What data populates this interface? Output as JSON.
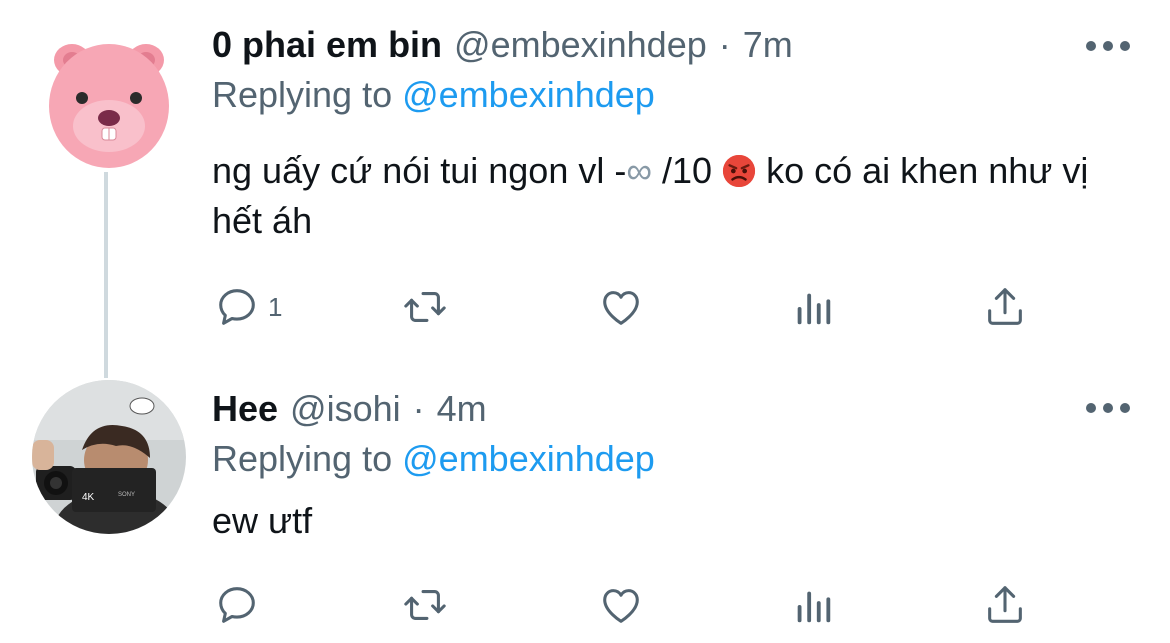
{
  "tweets": [
    {
      "display_name": "0 phai em bin",
      "handle": "@embexinhdep",
      "separator": "·",
      "time": "7m",
      "replying_prefix": "Replying to",
      "replying_to": "@embexinhdep",
      "text_part1": "ng uấy cứ nói tui ngon vl -",
      "text_infinity": "∞",
      "text_part2": " /10",
      "text_part3": " ko có ai khen như vị hết áh",
      "emoji": "angry-face-emoji",
      "reply_count": "1",
      "avatar": "pink-beaver-avatar"
    },
    {
      "display_name": "Hee",
      "handle": "@isohi",
      "separator": "·",
      "time": "4m",
      "replying_prefix": "Replying to",
      "replying_to": "@embexinhdep",
      "text": "ew ưtf",
      "reply_count": "",
      "avatar": "person-with-camera-avatar"
    }
  ],
  "icons": [
    "reply-icon",
    "retweet-icon",
    "like-icon",
    "analytics-icon",
    "share-icon",
    "more-icon"
  ],
  "colors": {
    "text": "#0f1419",
    "secondary": "#536471",
    "link": "#1d9bf0",
    "thread_line": "#cfd9de"
  }
}
